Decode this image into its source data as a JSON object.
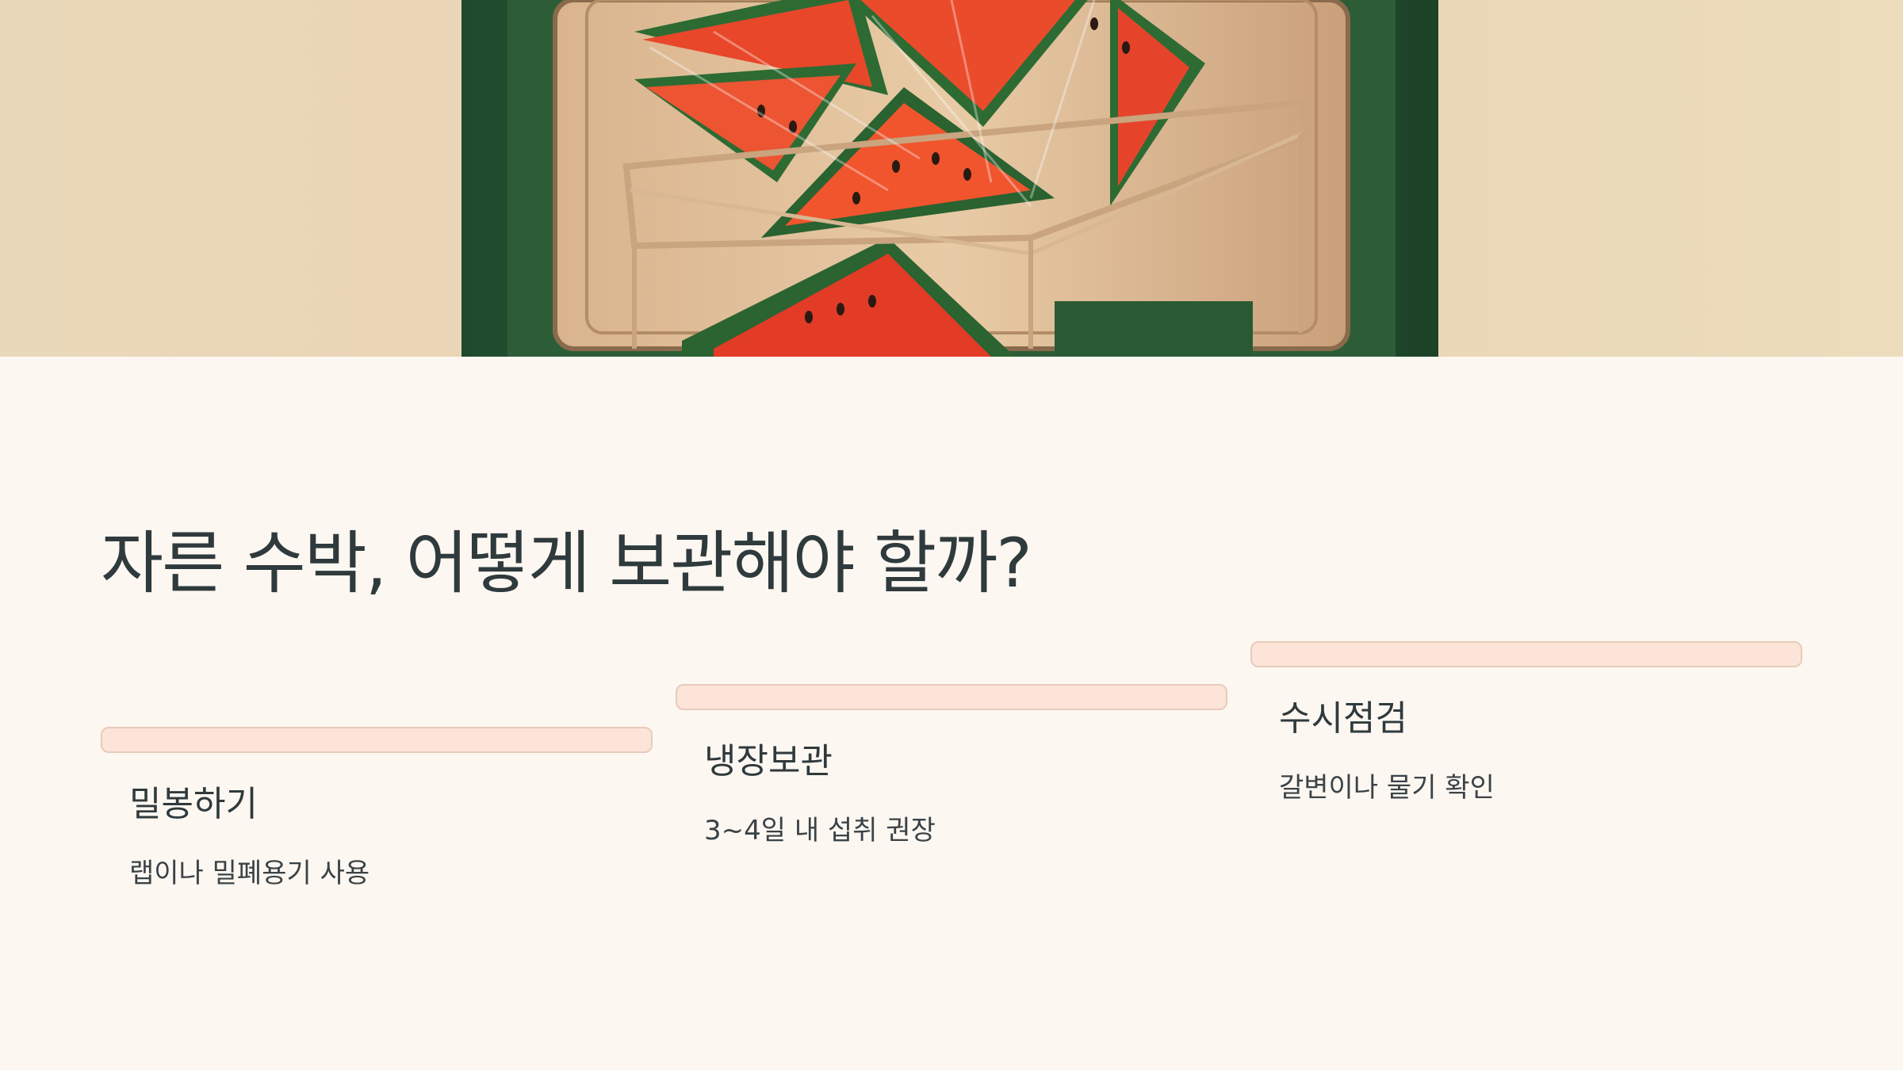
{
  "hero": {
    "image": "watermelon-slices-in-fridge-illustration"
  },
  "title": "자른 수박, 어떻게 보관해야 할까?",
  "steps": [
    {
      "title": "밀봉하기",
      "description": "랩이나 밀폐용기 사용"
    },
    {
      "title": "냉장보관",
      "description": "3~4일 내 섭취 권장"
    },
    {
      "title": "수시점검",
      "description": "갈변이나 물기 확인"
    }
  ],
  "colors": {
    "background": "#fdf7f1",
    "bar_fill": "#fde4d8",
    "bar_border": "#e8cbb9",
    "text": "#2f3a3d"
  }
}
